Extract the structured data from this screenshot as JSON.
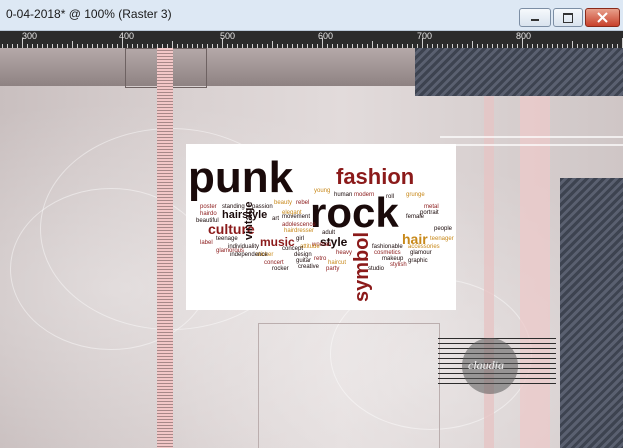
{
  "window": {
    "title": "0-04-2018* @ 100% (Raster 3)",
    "minimize_icon": "minimize-icon",
    "maximize_icon": "maximize-icon",
    "close_icon": "close-icon"
  },
  "ruler": {
    "labels": [
      "300",
      "400",
      "500",
      "600",
      "700",
      "800"
    ]
  },
  "canvas": {
    "word_cloud": [
      "punk",
      "rock",
      "fashion",
      "culture",
      "hairstyle",
      "vintage",
      "music",
      "style",
      "symbol",
      "hair",
      "young",
      "human",
      "modern",
      "roll",
      "grunge",
      "poster",
      "standing",
      "passion",
      "beauty",
      "rebel",
      "female",
      "metal",
      "portrait",
      "hairdo",
      "elegant",
      "art",
      "beautiful",
      "adolescence",
      "movement",
      "hairdresser",
      "adult",
      "woman",
      "girl",
      "people",
      "label",
      "attitude",
      "concept",
      "design",
      "heavy",
      "teenager",
      "fashionable",
      "cosmetics",
      "glamour",
      "makeup",
      "stylish",
      "graphic",
      "accessories",
      "sticker",
      "guitar",
      "retro",
      "haircut",
      "party",
      "studio",
      "individuality",
      "rocker",
      "concert",
      "creative",
      "independence",
      "glamorous",
      "teenage"
    ],
    "watermark": "claudia"
  },
  "colors": {
    "pink": "#f2c7c7",
    "dark_stripes": "#3d4350",
    "cloud_red": "#8b1a1a",
    "cloud_black": "#1a0a0a",
    "cloud_gold": "#c8891a"
  }
}
